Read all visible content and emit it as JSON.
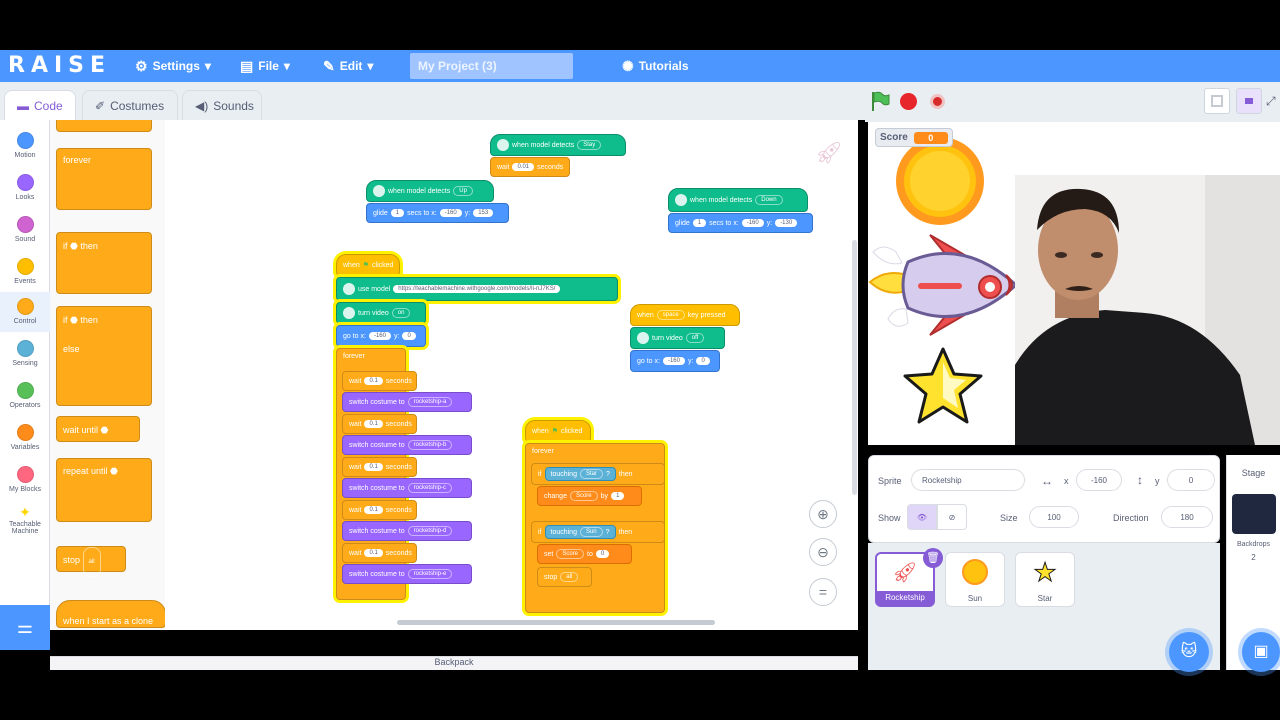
{
  "menu": {
    "logo": "RAISE",
    "settings": "Settings",
    "file": "File",
    "edit": "Edit",
    "project_title": "My Project (3)",
    "tutorials": "Tutorials"
  },
  "tabs": {
    "code": "Code",
    "costumes": "Costumes",
    "sounds": "Sounds"
  },
  "categories": [
    {
      "label": "Motion",
      "color": "#4c97ff"
    },
    {
      "label": "Looks",
      "color": "#9966ff"
    },
    {
      "label": "Sound",
      "color": "#cf63cf"
    },
    {
      "label": "Events",
      "color": "#ffbf00"
    },
    {
      "label": "Control",
      "color": "#ffab19"
    },
    {
      "label": "Sensing",
      "color": "#5cb1d6"
    },
    {
      "label": "Operators",
      "color": "#59c059"
    },
    {
      "label": "Variables",
      "color": "#ff8c1a"
    },
    {
      "label": "My Blocks",
      "color": "#ff6680"
    },
    {
      "label": "Teachable Machine",
      "color": "#ffd700"
    }
  ],
  "palette": {
    "forever": "forever",
    "if_then": "if",
    "then": "then",
    "if_else": "if",
    "then2": "then",
    "else": "else",
    "wait_until": "wait until",
    "repeat_until": "repeat until",
    "stop": "stop",
    "stop_opt": "all",
    "clone": "when I start as a clone"
  },
  "workspace": {
    "still_hat": "when model detects",
    "still_opt": "Stay",
    "still_wait": "wait",
    "still_wait_val": "0.01",
    "still_wait_unit": "seconds",
    "up_hat": "when model detects",
    "up_opt": "Up",
    "up_glide": "glide",
    "up_glide_secs": "1",
    "up_glide_mid": "secs to x:",
    "up_glide_x": "-160",
    "up_glide_y_label": "y:",
    "up_glide_y": "153",
    "down_hat": "when model detects",
    "down_opt": "Down",
    "down_glide": "glide",
    "down_glide_secs": "1",
    "down_glide_mid": "secs to x:",
    "down_glide_x": "-160",
    "down_glide_y_label": "y:",
    "down_glide_y": "-130",
    "flag_hat": "when",
    "flag_hat_end": "clicked",
    "use_model": "use model",
    "model_url": "https://teachablemachine.withgoogle.com/models/Ii-nJ7KS/",
    "turn_video": "turn video",
    "turn_video_opt": "on",
    "goto": "go to x:",
    "goto_x": "-160",
    "goto_y_label": "y:",
    "goto_y": "0",
    "forever": "forever",
    "wait1": "wait",
    "wait1_val": "0.1",
    "wait_unit": "seconds",
    "switch1": "switch costume to",
    "switch1_opt": "rocketship-a",
    "wait2_val": "0.1",
    "switch2_opt": "rocketship-b",
    "wait3_val": "0.1",
    "switch3_opt": "rocketship-c",
    "wait4_val": "0.1",
    "switch4_opt": "rocketship-d",
    "wait5_val": "0.1",
    "switch5_opt": "rocketship-e",
    "space_hat": "when",
    "space_key": "space",
    "space_hat_end": "key pressed",
    "turn_video2": "turn video",
    "turn_video2_opt": "off",
    "goto2": "go to x:",
    "goto2_x": "-160",
    "goto2_y_label": "y:",
    "goto2_y": "0",
    "flag2_hat": "when",
    "flag2_hat_end": "clicked",
    "forever2": "forever",
    "if1": "if",
    "touching1": "touching",
    "touching1_opt": "Star",
    "then1": "then",
    "change": "change",
    "change_var": "Score",
    "change_by": "by",
    "change_val": "1",
    "if2": "if",
    "touching2": "touching",
    "touching2_opt": "Sun",
    "then2": "then",
    "set": "set",
    "set_var": "Score",
    "set_to": "to",
    "set_val": "0",
    "stop": "stop",
    "stop_opt": "all",
    "backpack": "Backpack"
  },
  "stage": {
    "score_label": "Score",
    "score_value": "0"
  },
  "sprite_info": {
    "sprite_label": "Sprite",
    "sprite_name": "Rocketship",
    "x_label": "x",
    "x_val": "-160",
    "y_label": "y",
    "y_val": "0",
    "show_label": "Show",
    "size_label": "Size",
    "size_val": "100",
    "direction_label": "Direction",
    "direction_val": "180"
  },
  "sprites": [
    {
      "name": "Rocketship"
    },
    {
      "name": "Sun"
    },
    {
      "name": "Star"
    }
  ],
  "stage_panel": {
    "title": "Stage",
    "backdrops_label": "Backdrops",
    "backdrops_count": "2"
  },
  "colors": {
    "menu_blue": "#4c97ff",
    "control_orange": "#ffab19",
    "events_yellow": "#ffbf00",
    "extension_green": "#0fbd8c",
    "looks_purple": "#9966ff",
    "highlight": "#fff200"
  }
}
